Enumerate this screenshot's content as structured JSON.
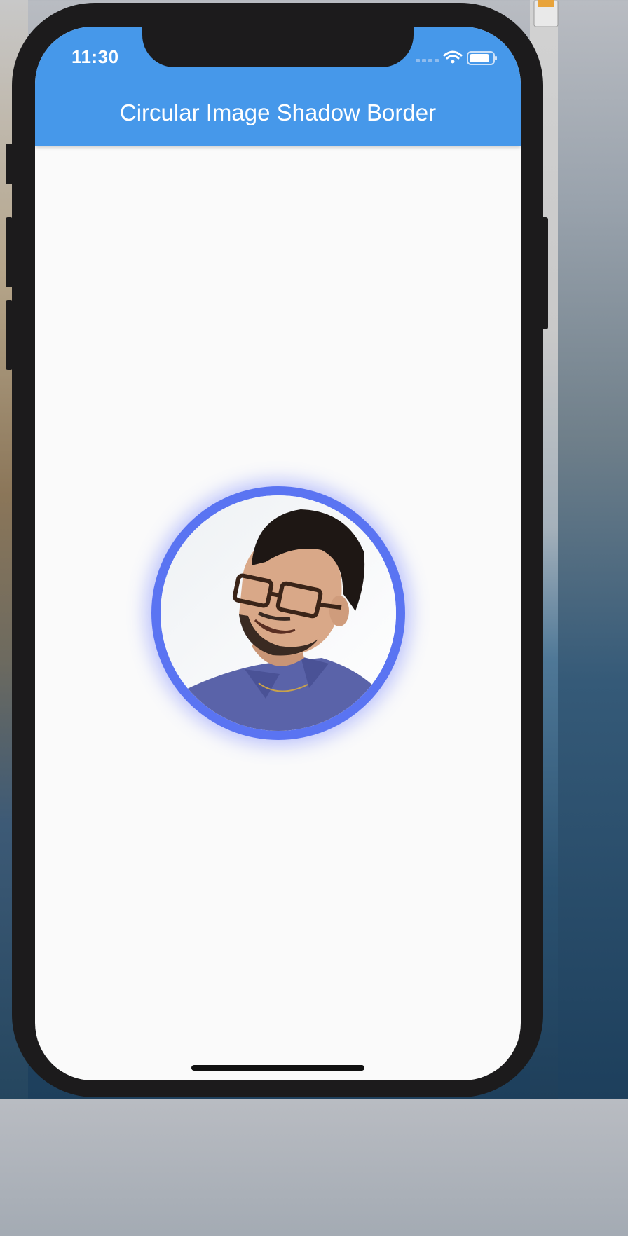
{
  "status_bar": {
    "time": "11:30"
  },
  "app_bar": {
    "title": "Circular Image Shadow Border"
  },
  "avatar": {
    "ring_color": "#5a74f2",
    "shadow_color": "#7080ff"
  },
  "colors": {
    "app_bar": "#4698ea",
    "background": "#fafafa"
  }
}
